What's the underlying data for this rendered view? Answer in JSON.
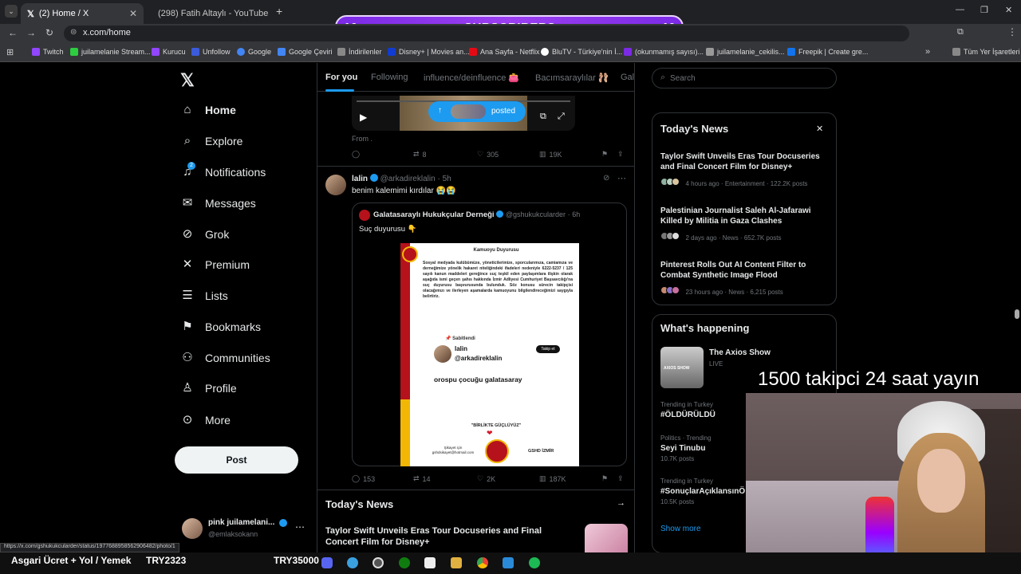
{
  "browser": {
    "tabs": [
      {
        "label": "(2) Home / X"
      },
      {
        "label": "(298) Fatih Altaylı - YouTube"
      }
    ],
    "url": "x.com/home",
    "bookmarks": [
      "Twitch",
      "juilamelanie Stream...",
      "Kurucu",
      "Unfollow",
      "Google",
      "Google Çeviri",
      "İndirilenler",
      "Disney+ | Movies an...",
      "Ana Sayfa - Netflix",
      "BluTV - Türkiye'nin İ...",
      "(okunmamış sayısı)...",
      "juilamelanie_cekilis...",
      "Freepik | Create gre..."
    ],
    "all_bookmarks": "Tüm Yer İşaretleri",
    "status_url": "https://x.com/gshukukcularder/status/1977688958562906482/photo/1"
  },
  "overlay": {
    "subs_left": "16",
    "subs_label": "SUBSCRIBERS",
    "subs_right": "10",
    "goal_text": "1500 takipci 24 saat yayın",
    "ticker_left": "Asgari Ücret + Yol / Yemek",
    "ticker_mid": "TRY2323",
    "ticker_right": "TRY35000"
  },
  "nav": {
    "items": [
      "Home",
      "Explore",
      "Notifications",
      "Messages",
      "Grok",
      "Premium",
      "Lists",
      "Bookmarks",
      "Communities",
      "Profile",
      "More"
    ],
    "notif_badge": "2",
    "post_button": "Post",
    "account": {
      "name": "pink juilamelani...",
      "handle": "@emlaksokann"
    }
  },
  "feed": {
    "tabs": [
      "For you",
      "Following",
      "influence/deinfluence 👛",
      "Bacımsaraylılar 🩰",
      "Gala"
    ],
    "posted_pill": "posted",
    "prev_post": {
      "caption": "From .",
      "stats": {
        "replies": "",
        "reposts": "8",
        "likes": "305",
        "views": "19K"
      }
    },
    "post": {
      "name": "lalin",
      "handle": "@arkadireklalin",
      "time": "5h",
      "text": "benim kalemimi kırdılar 😭😭",
      "quote": {
        "name": "Galatasaraylı Hukukçular Derneği",
        "handle": "@gshukukcularder",
        "time": "6h",
        "text": "Suç duyurusu 👇",
        "doc": {
          "title": "Kamuoyu Duyurusu",
          "body": "Sosyal medyada kulübümüze, yöneticilerimize, sporcularımıza, camiamıza ve derneğimize yönelik hakaret niteliğindeki ifadeleri nedeniyle 6222-5237 / 125 sayılı kanun maddeleri gereğince suç teşkil eden paylaşımlara ilişkin olarak aşağıda ismi geçen şahıs hakkında İzmir Adliyesi Cumhuriyet Başsavcılığı'na suç duyurusu başvurusunda bulunduk. Söz konusu sürecin takipçisi olacağımızı ve ilerleyen aşamalarda kamuoyunu bilgilendireceğimizi saygıyla belirtiriz.",
          "pinned": "Sabitlendi",
          "inner_name": "lalin",
          "inner_handle": "@arkadireklalin",
          "follow": "Takip et",
          "inner_text": "orospu çocuğu galatasaray",
          "slogan": "\"BİRLİKTE GÜÇLÜYÜZ\"",
          "complaint": "Şikayet için\ngshdsikayet@hotmail.com",
          "org": "GSHD İZMİR"
        }
      },
      "stats": {
        "replies": "153",
        "reposts": "14",
        "likes": "2K",
        "views": "187K"
      }
    },
    "news_heading": "Today's News",
    "news_item": "Taylor Swift Unveils Eras Tour Docuseries and Final Concert Film for Disney+"
  },
  "sidebar": {
    "search_placeholder": "Search",
    "news_title": "Today's News",
    "news": [
      {
        "title": "Taylor Swift Unveils Eras Tour Docuseries and Final Concert Film for Disney+",
        "meta": "4 hours ago · Entertainment · 122.2K posts"
      },
      {
        "title": "Palestinian Journalist Saleh Al-Jafarawi Killed by Militia in Gaza Clashes",
        "meta": "2 days ago · News · 652.7K posts"
      },
      {
        "title": "Pinterest Rolls Out AI Content Filter to Combat Synthetic Image Flood",
        "meta": "23 hours ago · News · 6,215 posts"
      }
    ],
    "happening_title": "What's happening",
    "live": {
      "title": "The Axios Show",
      "status": "LIVE",
      "thumb_text": "AXIOS SHOW"
    },
    "trends": [
      {
        "context": "Trending in Turkey",
        "name": "#ÖLDÜRÜLDÜ",
        "posts": ""
      },
      {
        "context": "Politics · Trending",
        "name": "Seyi Tinubu",
        "posts": "10.7K posts"
      },
      {
        "context": "Trending in Turkey",
        "name": "#SonuçlarAçıklansınÖ",
        "posts": "10.5K posts"
      }
    ],
    "show_more": "Show more"
  }
}
